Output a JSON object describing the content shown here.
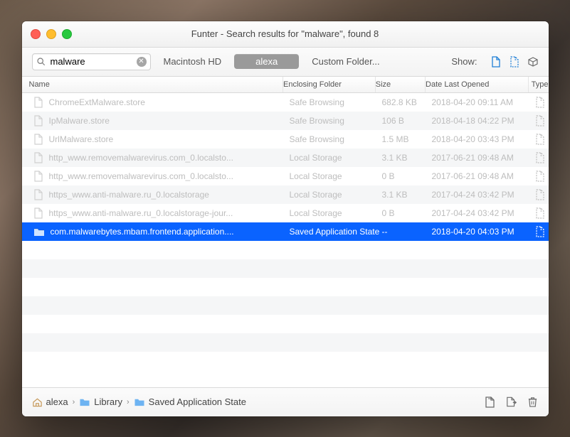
{
  "window": {
    "title": "Funter - Search results for \"malware\", found 8"
  },
  "toolbar": {
    "search_value": "malware",
    "search_placeholder": "",
    "scope_hd": "Macintosh HD",
    "scope_user": "alexa",
    "scope_custom": "Custom Folder...",
    "show_label": "Show:"
  },
  "columns": {
    "name": "Name",
    "folder": "Enclosing Folder",
    "size": "Size",
    "date": "Date Last Opened",
    "type": "Type"
  },
  "rows": [
    {
      "kind": "file",
      "name": "ChromeExtMalware.store",
      "folder": "Safe Browsing",
      "size": "682.8 KB",
      "date": "2018-04-20 09:11 AM",
      "selected": false
    },
    {
      "kind": "file",
      "name": "IpMalware.store",
      "folder": "Safe Browsing",
      "size": "106 B",
      "date": "2018-04-18 04:22 PM",
      "selected": false
    },
    {
      "kind": "file",
      "name": "UrlMalware.store",
      "folder": "Safe Browsing",
      "size": "1.5 MB",
      "date": "2018-04-20 03:43 PM",
      "selected": false
    },
    {
      "kind": "file",
      "name": "http_www.removemalwarevirus.com_0.localsto...",
      "folder": "Local Storage",
      "size": "3.1 KB",
      "date": "2017-06-21 09:48 AM",
      "selected": false
    },
    {
      "kind": "file",
      "name": "http_www.removemalwarevirus.com_0.localsto...",
      "folder": "Local Storage",
      "size": "0 B",
      "date": "2017-06-21 09:48 AM",
      "selected": false
    },
    {
      "kind": "file",
      "name": "https_www.anti-malware.ru_0.localstorage",
      "folder": "Local Storage",
      "size": "3.1 KB",
      "date": "2017-04-24 03:42 PM",
      "selected": false
    },
    {
      "kind": "file",
      "name": "https_www.anti-malware.ru_0.localstorage-jour...",
      "folder": "Local Storage",
      "size": "0 B",
      "date": "2017-04-24 03:42 PM",
      "selected": false
    },
    {
      "kind": "folder",
      "name": "com.malwarebytes.mbam.frontend.application....",
      "folder": "Saved Application State",
      "size": "--",
      "date": "2018-04-20 04:03 PM",
      "selected": true
    }
  ],
  "breadcrumbs": [
    {
      "icon": "home",
      "label": "alexa"
    },
    {
      "icon": "folder-blue",
      "label": "Library"
    },
    {
      "icon": "folder-blue",
      "label": "Saved Application State"
    }
  ],
  "icons": {
    "file_visible": "file-visible-icon",
    "file_hidden": "file-hidden-icon",
    "cube": "cube-icon",
    "reveal": "reveal-icon",
    "unhide": "unhide-icon",
    "trash": "trash-icon"
  }
}
